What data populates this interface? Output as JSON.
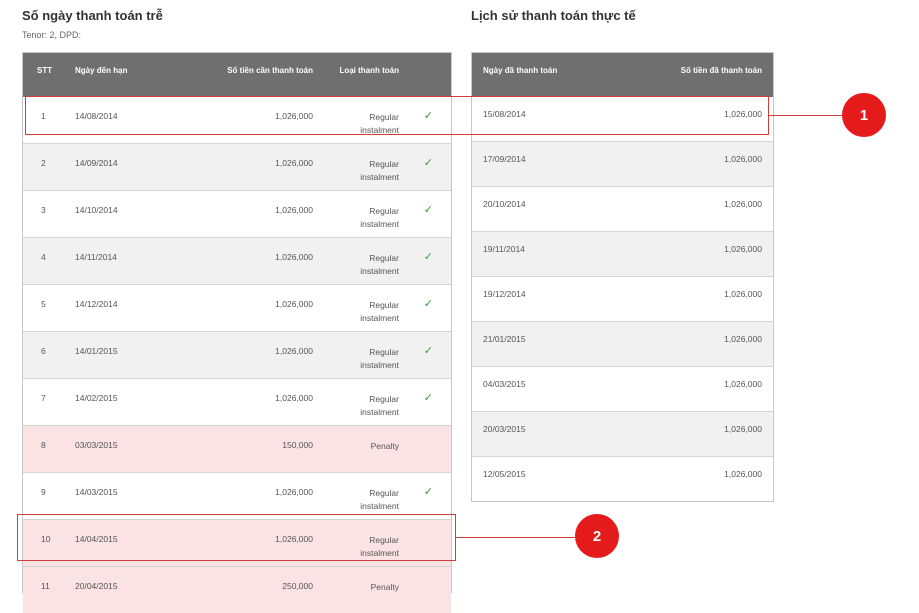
{
  "left": {
    "title": "Số ngày thanh toán trễ",
    "subtitle": "Tenor: 2, DPD:",
    "headers": {
      "stt": "STT",
      "due_date": "Ngày đến hạn",
      "amount": "Số tiền cần thanh toán",
      "type": "Loại thanh toán"
    },
    "rows": [
      {
        "stt": "1",
        "date": "14/08/2014",
        "amount": "1,026,000",
        "type_line1": "Regular",
        "type_line2": "instalment",
        "check": "✓"
      },
      {
        "stt": "2",
        "date": "14/09/2014",
        "amount": "1,026,000",
        "type_line1": "Regular",
        "type_line2": "instalment",
        "check": "✓"
      },
      {
        "stt": "3",
        "date": "14/10/2014",
        "amount": "1,026,000",
        "type_line1": "Regular",
        "type_line2": "instalment",
        "check": "✓"
      },
      {
        "stt": "4",
        "date": "14/11/2014",
        "amount": "1,026,000",
        "type_line1": "Regular",
        "type_line2": "instalment",
        "check": "✓"
      },
      {
        "stt": "5",
        "date": "14/12/2014",
        "amount": "1,026,000",
        "type_line1": "Regular",
        "type_line2": "instalment",
        "check": "✓"
      },
      {
        "stt": "6",
        "date": "14/01/2015",
        "amount": "1,026,000",
        "type_line1": "Regular",
        "type_line2": "instalment",
        "check": "✓"
      },
      {
        "stt": "7",
        "date": "14/02/2015",
        "amount": "1,026,000",
        "type_line1": "Regular",
        "type_line2": "instalment",
        "check": "✓"
      },
      {
        "stt": "8",
        "date": "03/03/2015",
        "amount": "150,000",
        "type_line1": "Penalty",
        "type_line2": "",
        "check": ""
      },
      {
        "stt": "9",
        "date": "14/03/2015",
        "amount": "1,026,000",
        "type_line1": "Regular",
        "type_line2": "instalment",
        "check": "✓"
      },
      {
        "stt": "10",
        "date": "14/04/2015",
        "amount": "1,026,000",
        "type_line1": "Regular",
        "type_line2": "instalment",
        "check": ""
      },
      {
        "stt": "11",
        "date": "20/04/2015",
        "amount": "250,000",
        "type_line1": "Penalty",
        "type_line2": "",
        "check": ""
      }
    ]
  },
  "right": {
    "title": "Lịch sử thanh toán thực tế",
    "headers": {
      "paid_date": "Ngày đã thanh toán",
      "paid_amount": "Số tiền đã thanh toán"
    },
    "rows": [
      {
        "date": "15/08/2014",
        "amount": "1,026,000"
      },
      {
        "date": "17/09/2014",
        "amount": "1,026,000"
      },
      {
        "date": "20/10/2014",
        "amount": "1,026,000"
      },
      {
        "date": "19/11/2014",
        "amount": "1,026,000"
      },
      {
        "date": "19/12/2014",
        "amount": "1,026,000"
      },
      {
        "date": "21/01/2015",
        "amount": "1,026,000"
      },
      {
        "date": "04/03/2015",
        "amount": "1,026,000"
      },
      {
        "date": "20/03/2015",
        "amount": "1,026,000"
      },
      {
        "date": "12/05/2015",
        "amount": "1,026,000"
      }
    ]
  },
  "annotations": {
    "badge1": "1",
    "badge2": "2"
  },
  "colors": {
    "accent_red": "#e51a1a",
    "check_green": "#3a9a3a",
    "header_gray": "#6f6f6f",
    "penalty_row": "#fbe3e3"
  }
}
